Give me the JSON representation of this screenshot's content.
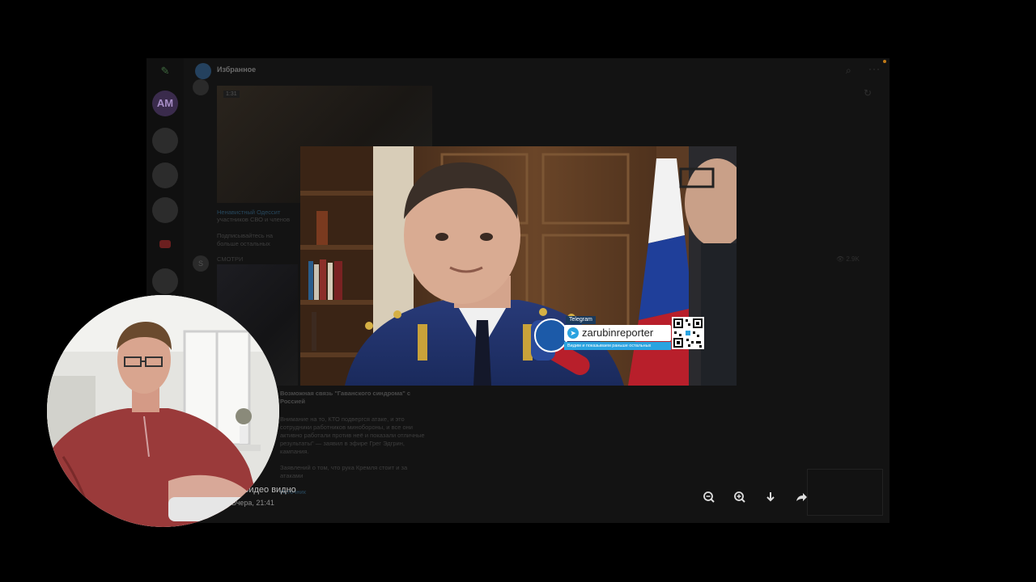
{
  "chat": {
    "title": "Избранное",
    "rail_avatar_initials": "AM"
  },
  "messages": [
    {
      "video_badge": "1:31",
      "channel_link": "Ненавистный Одессит",
      "text_line_1": "участников СВО и членов",
      "text_line_2": "Подписывайтесь на",
      "text_line_3": "больше остальных",
      "channel_link_2": "Ненавистный Одессит"
    },
    {
      "sender": "СМОТРИ",
      "sender_initial": "S",
      "views": "👁 2.9K"
    }
  ],
  "post_fragment": {
    "bold": "Возможная связь \"Гаванского синдрома\" с",
    "bold_2": "Россией",
    "lines": [
      "Внимание на то, КТО подвергся атаке, и это",
      "сотрудники работников минобороны, и все они",
      "активно работали против неё и показали отличные",
      "результаты\" — заявил в эфире Грег Эдгрин,",
      "кампания.",
      "Заявлений о том, что рука Кремля стоит и за",
      "атаками"
    ],
    "source_link": "Источник"
  },
  "video": {
    "overlay_label": "Telegram",
    "overlay_handle": "zarubinreporter",
    "overlay_subtitle": "Видим и показываем раньше остальных"
  },
  "caption": {
    "title": "Видео видно",
    "time": "Вчера, 21:41"
  },
  "toolbar": {
    "zoom_out": "zoom-out-icon",
    "zoom_in": "zoom-in-icon",
    "download": "download-icon",
    "forward": "forward-icon",
    "more": "more-icon"
  },
  "colors": {
    "background": "#000000",
    "app_window": "#131313",
    "link": "#27485e",
    "overlay_accent": "#2aa3e0",
    "flag_blue": "#1f3f9a",
    "flag_red": "#b81f2b"
  }
}
